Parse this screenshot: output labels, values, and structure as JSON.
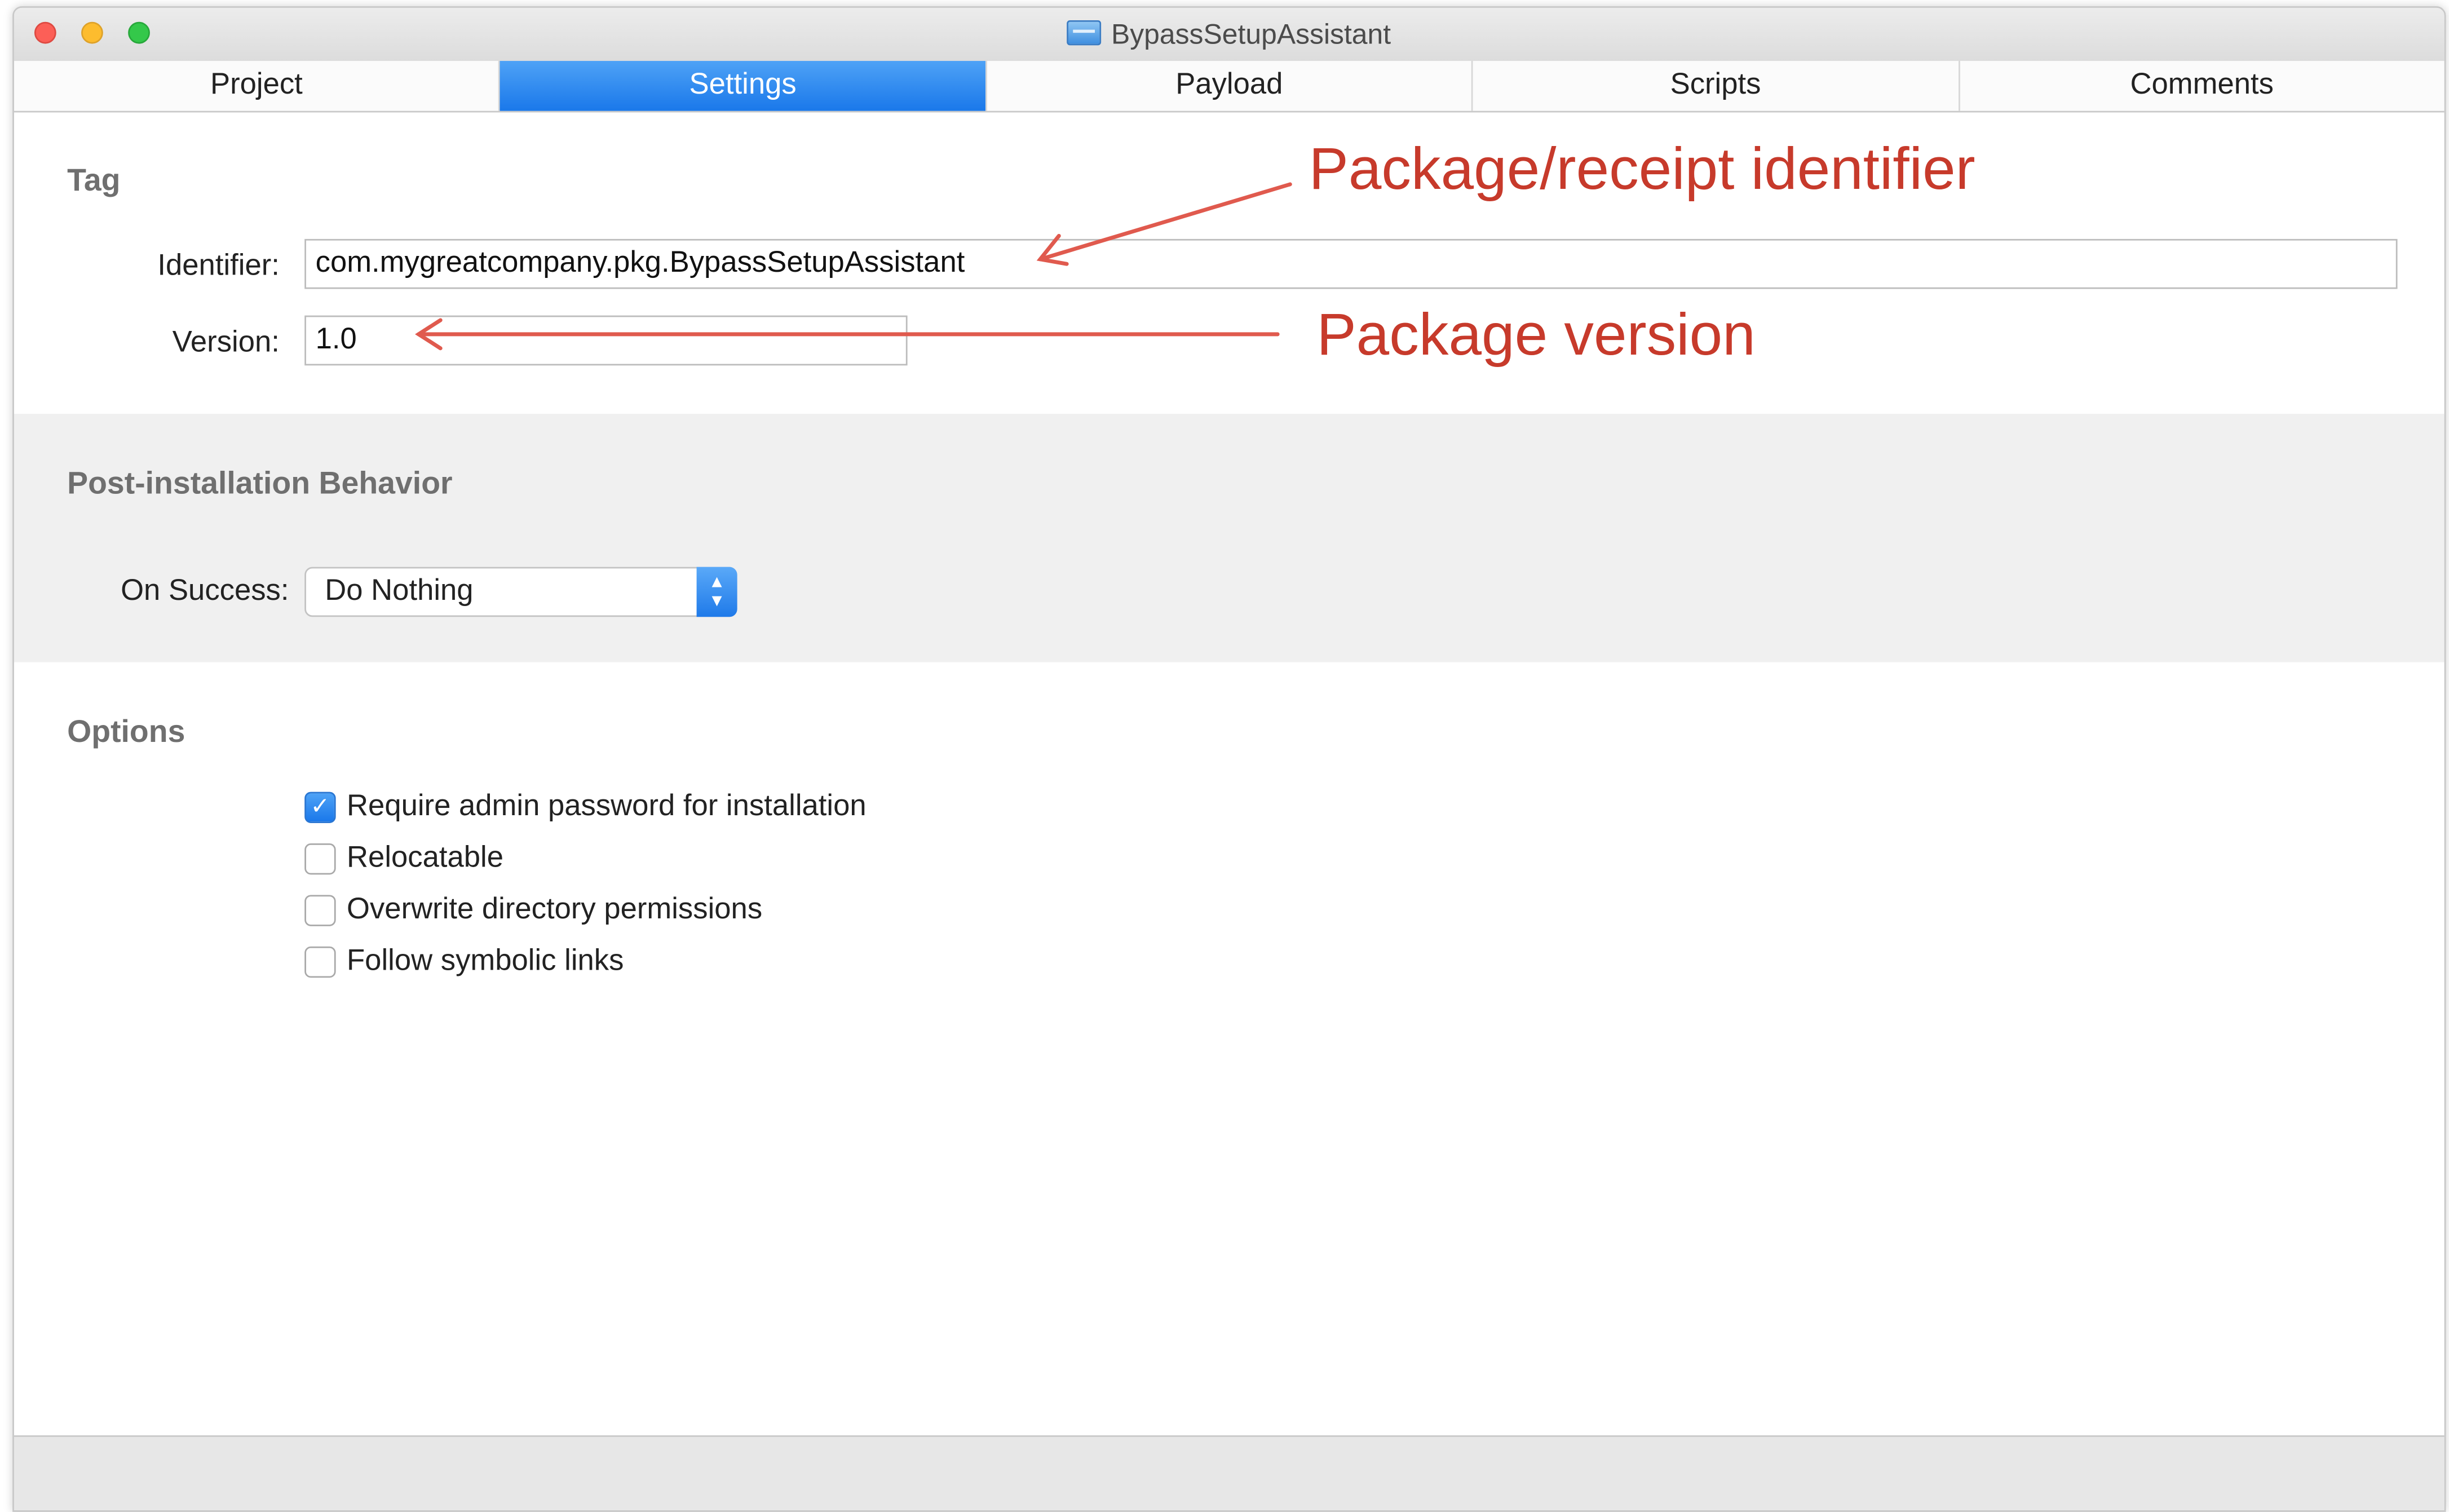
{
  "window": {
    "title": "BypassSetupAssistant",
    "title_icon": "package-icon"
  },
  "tabs": [
    {
      "label": "Project",
      "active": false
    },
    {
      "label": "Settings",
      "active": true
    },
    {
      "label": "Payload",
      "active": false
    },
    {
      "label": "Scripts",
      "active": false
    },
    {
      "label": "Comments",
      "active": false
    }
  ],
  "tag_section": {
    "heading": "Tag",
    "identifier_label": "Identifier:",
    "identifier_value": "com.mygreatcompany.pkg.BypassSetupAssistant",
    "version_label": "Version:",
    "version_value": "1.0"
  },
  "post_install": {
    "heading": "Post-installation Behavior",
    "on_success_label": "On Success:",
    "on_success_value": "Do Nothing"
  },
  "options": {
    "heading": "Options",
    "items": [
      {
        "label": "Require admin password for installation",
        "checked": true
      },
      {
        "label": "Relocatable",
        "checked": false
      },
      {
        "label": "Overwrite directory permissions",
        "checked": false
      },
      {
        "label": "Follow symbolic links",
        "checked": false
      }
    ]
  },
  "annotations": {
    "identifier_note": "Package/receipt identifier",
    "version_note": "Package version",
    "color": "#c73a2b"
  },
  "colors": {
    "accent": "#1a78ea",
    "close": "#fc5f57",
    "minimize": "#fdbc2e",
    "maximize": "#34c84a"
  }
}
